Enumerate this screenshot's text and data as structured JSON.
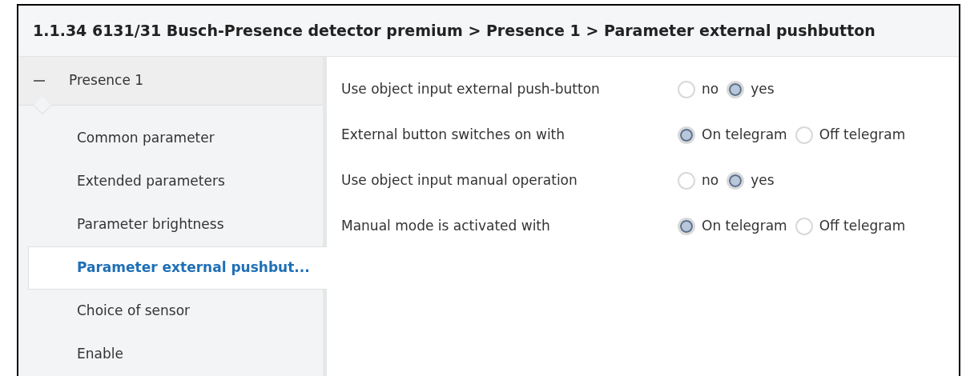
{
  "window": {
    "title": "1.1.34 6131/31 Busch-Presence detector premium > Presence 1 > Parameter external pushbutton"
  },
  "sidebar": {
    "group": {
      "label": "Presence 1",
      "expanded": true
    },
    "items": [
      {
        "label": "Common parameter",
        "selected": false
      },
      {
        "label": "Extended parameters",
        "selected": false
      },
      {
        "label": "Parameter brightness",
        "selected": false
      },
      {
        "label": "Parameter external pushbut...",
        "selected": true
      },
      {
        "label": "Choice of sensor",
        "selected": false
      },
      {
        "label": "Enable",
        "selected": false
      }
    ]
  },
  "parameters": [
    {
      "label": "Use object input external push-button",
      "options": [
        {
          "label": "no",
          "selected": false
        },
        {
          "label": "yes",
          "selected": true
        }
      ]
    },
    {
      "label": "External button switches on with",
      "options": [
        {
          "label": "On telegram",
          "selected": true
        },
        {
          "label": "Off telegram",
          "selected": false
        }
      ]
    },
    {
      "label": "Use object input manual operation",
      "options": [
        {
          "label": "no",
          "selected": false
        },
        {
          "label": "yes",
          "selected": true
        }
      ]
    },
    {
      "label": "Manual mode is activated with",
      "options": [
        {
          "label": "On telegram",
          "selected": true
        },
        {
          "label": "Off telegram",
          "selected": false
        }
      ]
    }
  ]
}
